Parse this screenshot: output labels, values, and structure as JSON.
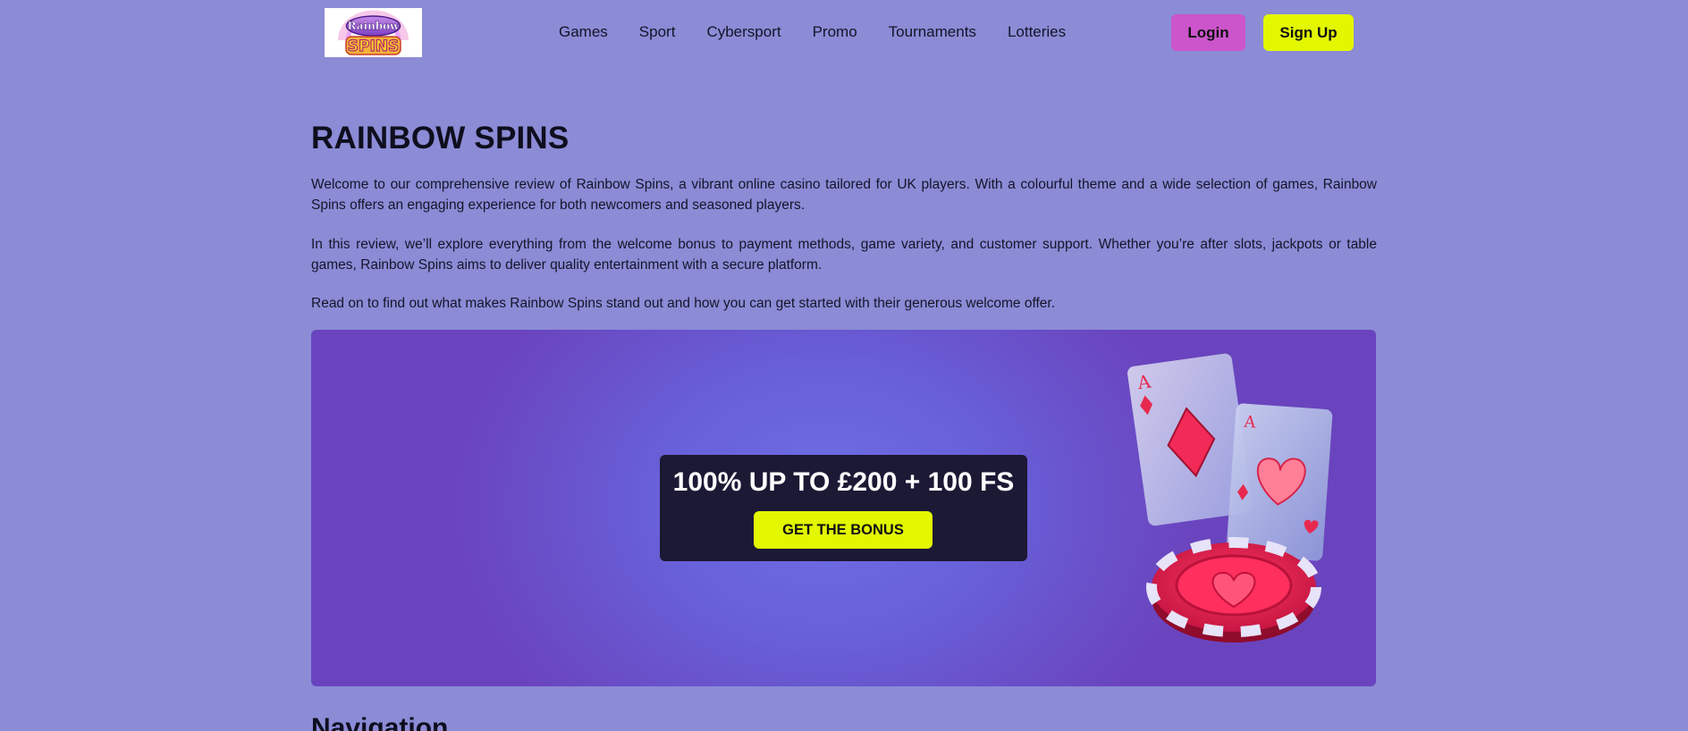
{
  "header": {
    "logo": {
      "line1": "Rainbow",
      "line2": "SPINS"
    },
    "nav": [
      "Games",
      "Sport",
      "Cybersport",
      "Promo",
      "Tournaments",
      "Lotteries"
    ],
    "login_label": "Login",
    "signup_label": "Sign Up"
  },
  "main": {
    "title": "RAINBOW SPINS",
    "paragraphs": [
      "Welcome to our comprehensive review of Rainbow Spins, a vibrant online casino tailored for UK players. With a colourful theme and a wide selection of games, Rainbow Spins offers an engaging experience for both newcomers and seasoned players.",
      "In this review, we’ll explore everything from the welcome bonus to payment methods, game variety, and customer support. Whether you’re after slots, jackpots or table games, Rainbow Spins aims to deliver quality entertainment with a secure platform.",
      "Read on to find out what makes Rainbow Spins stand out and how you can get started with their generous welcome offer."
    ],
    "banner": {
      "offer_title": "100% UP TO £200 + 100 FS",
      "cta_label": "GET THE BONUS"
    },
    "section_heading": "Navigation"
  },
  "colors": {
    "page_bg": "#8b8bd6",
    "login_button": "#cc55cc",
    "accent_yellow": "#e2f700",
    "offer_box": "#1c1935",
    "banner_purple": "#6a44be"
  },
  "icons": [
    "playing-cards-icon",
    "casino-chip-icon"
  ]
}
